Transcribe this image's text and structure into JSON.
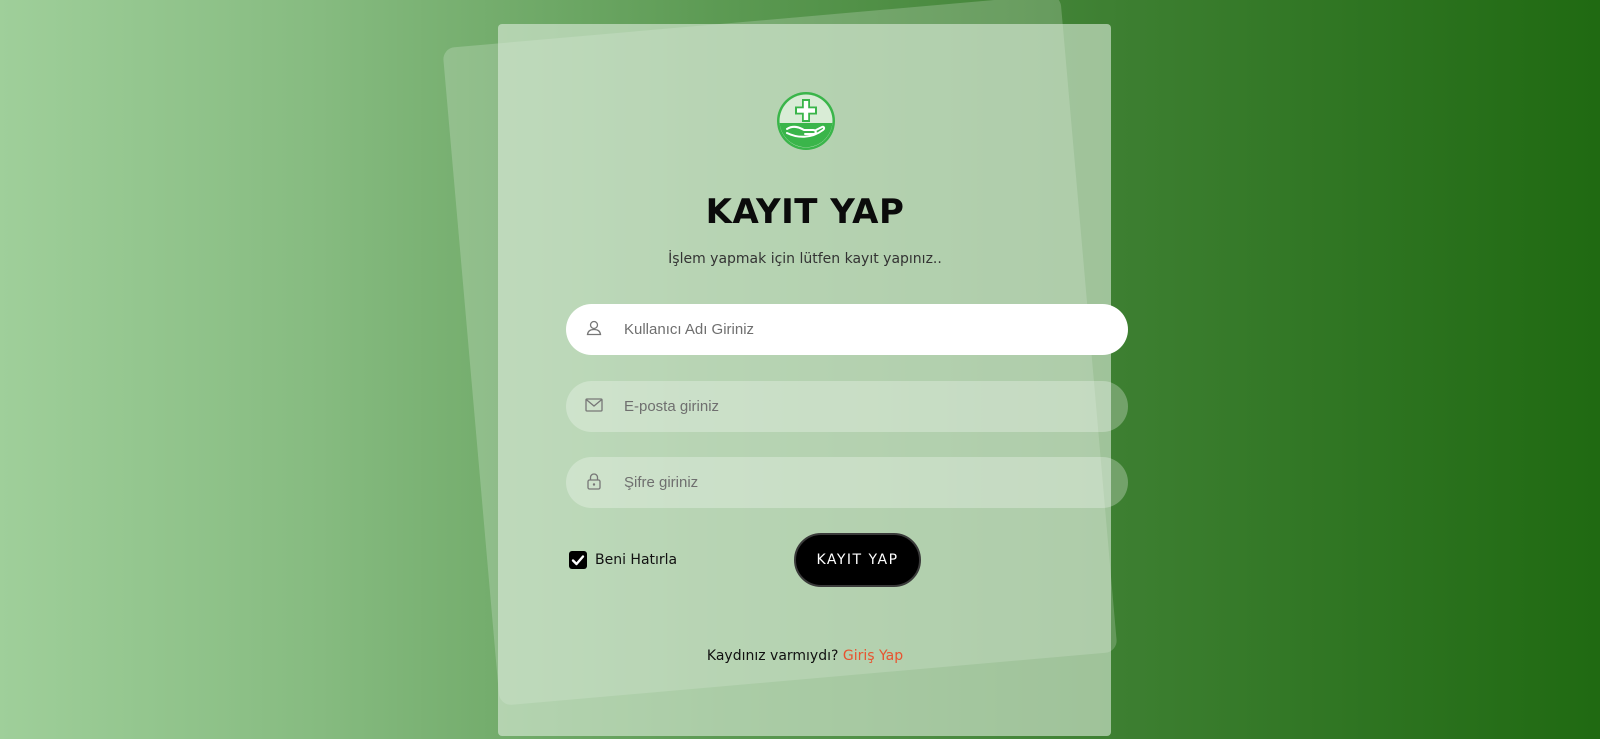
{
  "title": "KAYIT YAP",
  "subtitle": "İşlem yapmak için lütfen kayıt yapınız..",
  "fields": {
    "username": {
      "placeholder": "Kullanıcı Adı Giriniz",
      "value": "",
      "icon": "user-icon"
    },
    "email": {
      "placeholder": "E-posta giriniz",
      "value": "",
      "icon": "mail-icon"
    },
    "password": {
      "placeholder": "Şifre giriniz",
      "value": "",
      "icon": "lock-icon"
    }
  },
  "remember": {
    "label": "Beni Hatırla",
    "checked": true
  },
  "submit_label": "KAYIT YAP",
  "footer": {
    "text": "Kaydınız varmıydı?",
    "link": "Giriş Yap"
  },
  "colors": {
    "brand_green": "#3ab54a",
    "link": "#e8532f",
    "button": "#000000"
  },
  "logo": {
    "icon": "medical-cross-hand-logo"
  }
}
